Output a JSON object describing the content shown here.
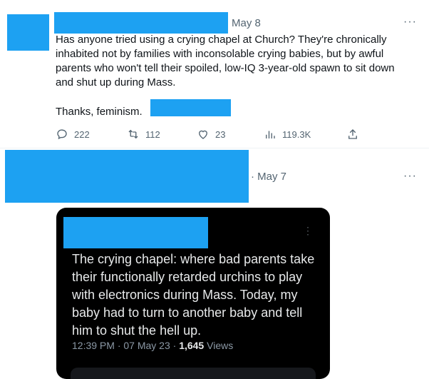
{
  "tweet1": {
    "date": "May 8",
    "more_label": "···",
    "text": "Has anyone tried using a crying chapel at Church? They're chronically inhabited not by families with inconsolable crying babies, but by awful parents who won't tell their spoiled, low-IQ 3-year-old spawn to sit down and shut up during Mass.",
    "text2": "Thanks, feminism.",
    "actions": {
      "replies": "222",
      "retweets": "112",
      "likes": "23",
      "views": "119.3K"
    }
  },
  "tweet2": {
    "date": "· May 7",
    "more_label": "···",
    "embed": {
      "more_label": "⋮",
      "text": "The crying chapel: where bad parents take their functionally  retarded urchins to play with electronics during Mass. Today, my baby had to turn to another baby and tell him to shut the hell up.",
      "time": "12:39 PM · 07 May 23 · ",
      "views_count": "1,645",
      "views_label": " Views"
    }
  },
  "colors": {
    "redaction": "#1da1f2",
    "text": "#0f1419",
    "muted": "#536471",
    "embed_bg": "#000000"
  }
}
